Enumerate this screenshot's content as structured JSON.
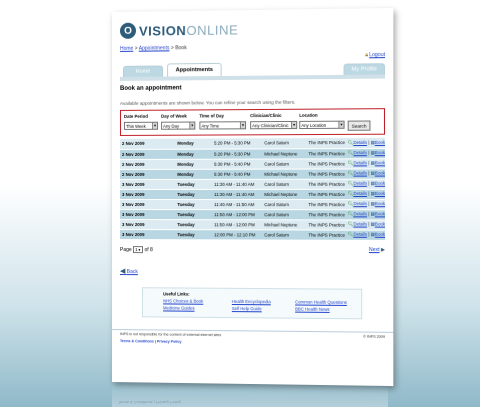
{
  "logo": {
    "icon": "circle-logo-icon",
    "glyph": "O",
    "bold": "VISION",
    "light": "ONLINE"
  },
  "breadcrumb": {
    "home": "Home",
    "sep1": " > ",
    "appointments": "Appointments",
    "sep2": " > ",
    "current": "Book"
  },
  "logout": "Logout",
  "tabs": {
    "home": "Home",
    "appointments": "Appointments",
    "profile": "My Profile"
  },
  "section_title": "Book an appointment",
  "intro": "Available appointments are shown below. You can refine your search using the filters.",
  "filters": {
    "date_period": {
      "label": "Date Period",
      "value": "This Week"
    },
    "day_of_week": {
      "label": "Day of Week",
      "value": "Any Day"
    },
    "time_of_day": {
      "label": "Time of Day",
      "value": "Any Time"
    },
    "clinician": {
      "label": "Clinician/Clinic",
      "value": "Any Clinician/Clinic"
    },
    "location": {
      "label": "Location",
      "value": "Any Location"
    },
    "search_label": "Search"
  },
  "actions": {
    "details": "Details",
    "book": "Book",
    "sep": " | "
  },
  "rows": [
    {
      "date": "2 Nov 2009",
      "day": "Monday",
      "time": "5:20 PM - 5:30 PM",
      "clinician": "Carol Saturn",
      "location": "The INPS Practice"
    },
    {
      "date": "2 Nov 2009",
      "day": "Monday",
      "time": "5:20 PM - 5:30 PM",
      "clinician": "Michael Neptune",
      "location": "The INPS Practice"
    },
    {
      "date": "2 Nov 2009",
      "day": "Monday",
      "time": "5:30 PM - 5:40 PM",
      "clinician": "Carol Saturn",
      "location": "The INPS Practice"
    },
    {
      "date": "2 Nov 2009",
      "day": "Monday",
      "time": "5:30 PM - 5:40 PM",
      "clinician": "Michael Neptune",
      "location": "The INPS Practice"
    },
    {
      "date": "3 Nov 2009",
      "day": "Tuesday",
      "time": "11:30 AM - 11:40 AM",
      "clinician": "Carol Saturn",
      "location": "The INPS Practice"
    },
    {
      "date": "3 Nov 2009",
      "day": "Tuesday",
      "time": "11:30 AM - 11:40 AM",
      "clinician": "Michael Neptune",
      "location": "The INPS Practice"
    },
    {
      "date": "3 Nov 2009",
      "day": "Tuesday",
      "time": "11:40 AM - 11:50 AM",
      "clinician": "Carol Saturn",
      "location": "The INPS Practice"
    },
    {
      "date": "3 Nov 2009",
      "day": "Tuesday",
      "time": "11:50 AM - 12:00 PM",
      "clinician": "Carol Saturn",
      "location": "The INPS Practice"
    },
    {
      "date": "3 Nov 2009",
      "day": "Tuesday",
      "time": "11:50 AM - 12:00 PM",
      "clinician": "Michael Neptune",
      "location": "The INPS Practice"
    },
    {
      "date": "3 Nov 2009",
      "day": "Tuesday",
      "time": "12:00 PM - 12:10 PM",
      "clinician": "Carol Saturn",
      "location": "The INPS Practice"
    }
  ],
  "pager": {
    "page_label": "Page",
    "current": "1",
    "of_label": "of 8",
    "next": "Next"
  },
  "back": "Back",
  "useful": {
    "title": "Useful Links:",
    "links": [
      "NHS Choices & Book",
      "Medicine Guides",
      "Health Encyclopedia",
      "Self Help Guide",
      "Common Health Questions",
      "BBC Health News"
    ]
  },
  "footer": {
    "disclaimer": "INPS is not responsible for the content of external internet sites",
    "links": "Terms & Conditions | Privacy Policy",
    "copyright": "© INPS 2009"
  },
  "colors": {
    "accent": "#2d5b7a",
    "filter_border": "#c0202a",
    "row_light": "#dcebf1",
    "row_dark": "#b8d7e2",
    "link": "#2244cc"
  }
}
